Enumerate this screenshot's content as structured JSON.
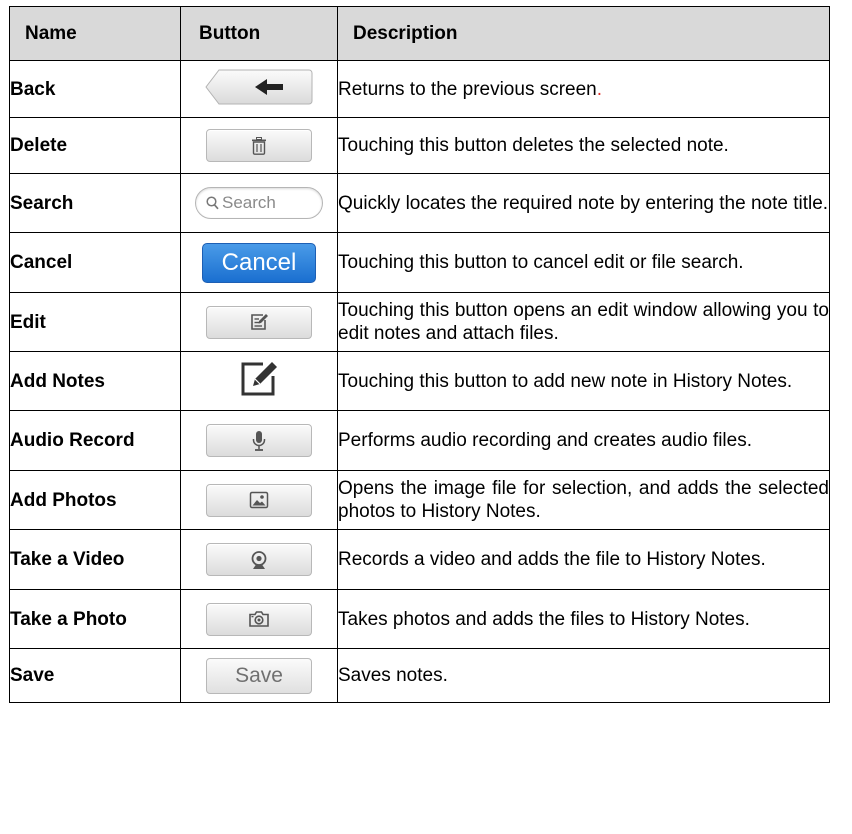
{
  "headers": {
    "name": "Name",
    "button": "Button",
    "description": "Description"
  },
  "rows": [
    {
      "name": "Back",
      "description": "Returns to the previous screen",
      "description_tail": ".",
      "icon": "back-arrow-icon"
    },
    {
      "name": "Delete",
      "description": "Touching this button deletes the selected note.",
      "icon": "trash-icon"
    },
    {
      "name": "Search",
      "description": "Quickly locates the required note by entering the note title.",
      "icon": "search-icon",
      "button_label": "Search"
    },
    {
      "name": "Cancel",
      "description": "Touching this button to cancel edit or file search.",
      "button_label": "Cancel"
    },
    {
      "name": "Edit",
      "description": "Touching this button opens an edit window allowing you to edit notes and attach files.",
      "icon": "edit-icon"
    },
    {
      "name": "Add Notes",
      "description": "Touching this button to add new note in History Notes.",
      "icon": "add-note-icon"
    },
    {
      "name": "Audio Record",
      "description": "Performs audio recording and creates audio files.",
      "icon": "microphone-icon"
    },
    {
      "name": "Add Photos",
      "description": "Opens the image file for selection, and adds the selected photos to History Notes.",
      "icon": "image-icon"
    },
    {
      "name": "Take a Video",
      "description": "Records a video and adds the file to History Notes.",
      "icon": "webcam-icon"
    },
    {
      "name": "Take a Photo",
      "description": "Takes photos and adds the files to History Notes.",
      "icon": "camera-icon"
    },
    {
      "name": "Save",
      "description": "Saves notes.",
      "button_label": "Save"
    }
  ],
  "colors": {
    "header_bg": "#d9d9d9",
    "cancel_blue": "#1a6fd0",
    "accent_red": "#e0302a"
  }
}
